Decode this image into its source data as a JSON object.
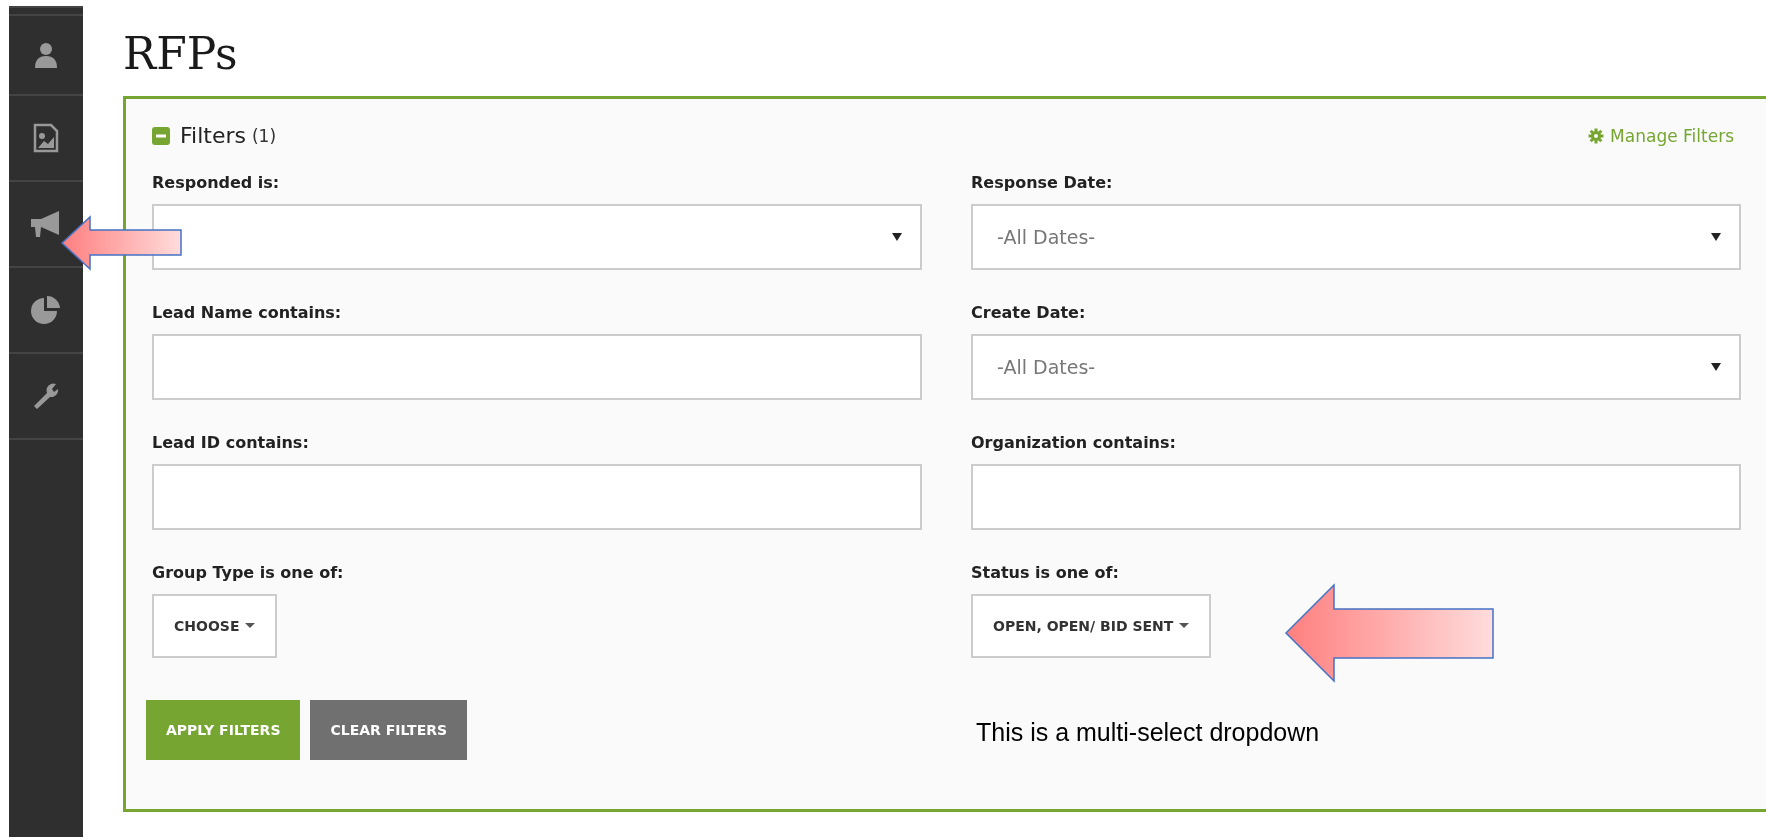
{
  "page": {
    "title": "RFPs"
  },
  "filters": {
    "title": "Filters",
    "count": "(1)",
    "expanded": true,
    "manage_link": "Manage Filters",
    "fields": [
      {
        "kind": "select",
        "label": "Responded is:"
      },
      {
        "kind": "select",
        "label": "Response Date:",
        "placeholder": "-All Dates-"
      },
      {
        "kind": "text",
        "label": "Lead Name contains:"
      },
      {
        "kind": "select",
        "label": "Create Date:",
        "placeholder": "-All Dates-"
      },
      {
        "kind": "text",
        "label": "Lead ID contains:"
      },
      {
        "kind": "text",
        "label": "Organization contains:"
      },
      {
        "kind": "multiselect",
        "label": "Group Type is one of:",
        "value": "CHOOSE"
      },
      {
        "kind": "multiselect",
        "label": "Status is one of:",
        "value": "OPEN, OPEN/ BID SENT"
      }
    ],
    "buttons": [
      {
        "label": "APPLY FILTERS",
        "kind": "primary"
      },
      {
        "label": "CLEAR FILTERS",
        "kind": "secondary"
      }
    ]
  },
  "annotation": {
    "text": "This is a multi-select dropdown"
  }
}
